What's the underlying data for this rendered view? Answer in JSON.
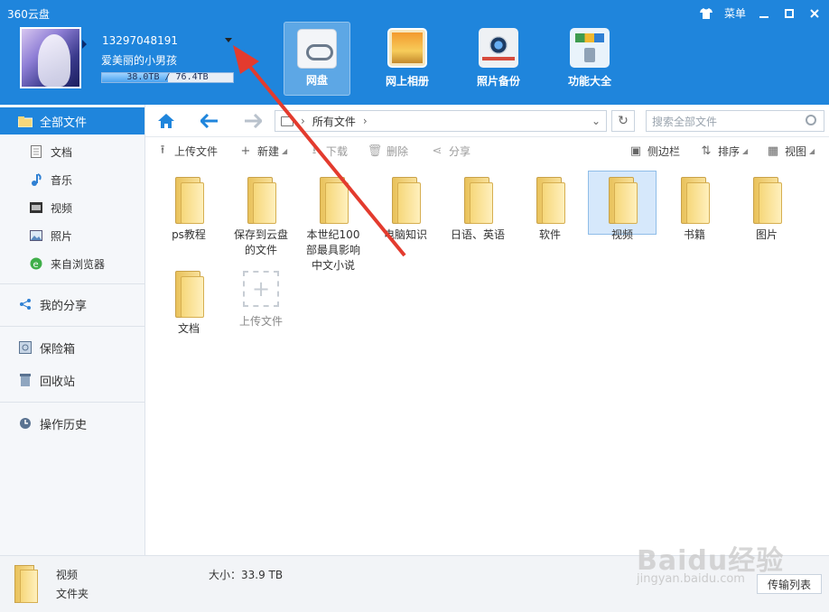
{
  "app": {
    "title": "360云盘"
  },
  "window_controls": {
    "menu_label": "菜单"
  },
  "account": {
    "phone": "13297048191",
    "nickname": "爱美丽的小男孩",
    "quota_text": "38.0TB / 76.4TB",
    "quota_fraction": 0.5
  },
  "nav": [
    {
      "label": "网盘",
      "icon": "cloud-disk-icon",
      "active": true
    },
    {
      "label": "网上相册",
      "icon": "photo-album-icon",
      "active": false
    },
    {
      "label": "照片备份",
      "icon": "camera-icon",
      "active": false
    },
    {
      "label": "功能大全",
      "icon": "toolbox-icon",
      "active": false
    }
  ],
  "sidebar": {
    "all_files": "全部文件",
    "items": [
      {
        "label": "文档",
        "icon": "document-icon"
      },
      {
        "label": "音乐",
        "icon": "music-note-icon"
      },
      {
        "label": "视频",
        "icon": "film-icon"
      },
      {
        "label": "照片",
        "icon": "image-icon"
      },
      {
        "label": "来自浏览器",
        "icon": "browser-icon"
      }
    ],
    "my_share": "我的分享",
    "safe_box": "保险箱",
    "recycle_bin": "回收站",
    "history": "操作历史"
  },
  "addressbar": {
    "path": "所有文件",
    "search_placeholder": "搜索全部文件"
  },
  "actions": {
    "upload": "上传文件",
    "new": "新建",
    "download": "下载",
    "delete": "删除",
    "share": "分享",
    "sidebar_toggle": "侧边栏",
    "sort": "排序",
    "view": "视图"
  },
  "files": [
    {
      "name": "ps教程"
    },
    {
      "name": "保存到云盘的文件"
    },
    {
      "name": "本世纪100部最具影响中文小说"
    },
    {
      "name": "电脑知识"
    },
    {
      "name": "日语、英语"
    },
    {
      "name": "软件"
    },
    {
      "name": "视频",
      "selected": true
    },
    {
      "name": "书籍"
    },
    {
      "name": "图片"
    },
    {
      "name": "文档"
    }
  ],
  "upload_tile": {
    "label": "上传文件"
  },
  "status": {
    "name": "视频",
    "type": "文件夹",
    "size_text": "大小：33.9 TB",
    "transfer_button": "传输列表"
  },
  "watermark": {
    "main": "Baidu经验",
    "sub": "jingyan.baidu.com"
  },
  "colors": {
    "brand": "#1f85dc",
    "arrow": "#e33b2e"
  }
}
